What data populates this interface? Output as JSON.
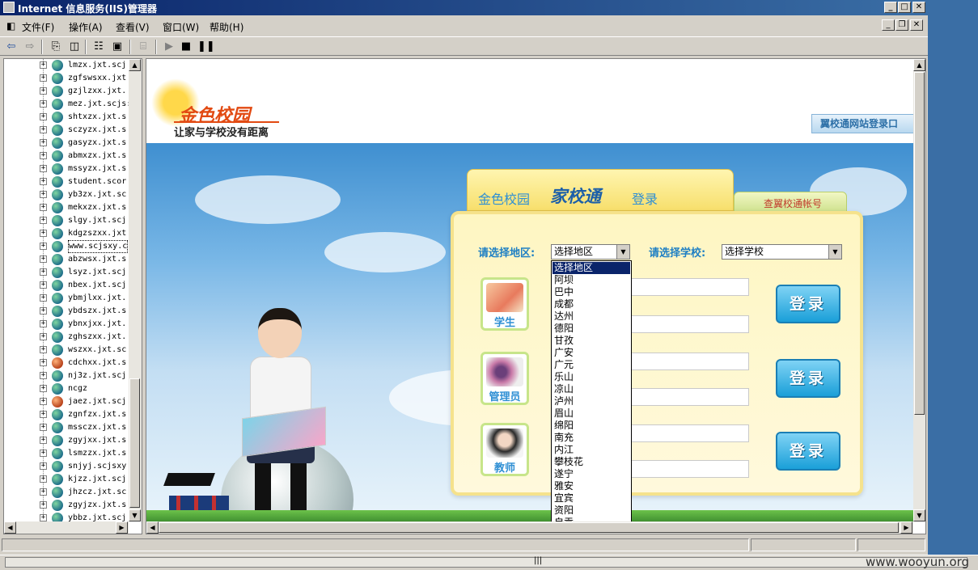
{
  "window": {
    "title": "Internet 信息服务(IIS)管理器"
  },
  "menu": {
    "file": "文件(F)",
    "action": "操作(A)",
    "view": "查看(V)",
    "window": "窗口(W)",
    "help": "帮助(H)"
  },
  "toolbar_icons": [
    "back-icon",
    "forward-icon",
    "up-folder-icon",
    "show-tree-icon",
    "properties-icon",
    "export-icon",
    "computer-icon",
    "play-icon",
    "stop-icon",
    "pause-icon"
  ],
  "tree": {
    "items": [
      "lmzx.jxt.scj",
      "zgfswsxx.jxt",
      "gzjlzxx.jxt.",
      "mez.jxt.scjs:",
      "shtxzx.jxt.s",
      "sczyzx.jxt.s",
      "gasyzx.jxt.s",
      "abmxzx.jxt.s",
      "mssyzx.jxt.s",
      "student.scor",
      "yb3zx.jxt.sc",
      "mekxzx.jxt.s",
      "slgy.jxt.scj",
      "kdgzszxx.jxt",
      "www.scjsxy.c",
      "abzwsx.jxt.s",
      "lsyz.jxt.scj",
      "nbex.jxt.scj",
      "ybmjlxx.jxt.",
      "ybdszx.jxt.s",
      "ybnxjxx.jxt.",
      "zghszxx.jxt.",
      "wszxx.jxt.sc",
      "cdchxx.jxt.s",
      "nj3z.jxt.scj",
      "ncgz",
      "jaez.jxt.scj",
      "zgnfzx.jxt.s",
      "mssczx.jxt.s",
      "zgyjxx.jxt.s",
      "lsmzzx.jxt.s",
      "snjyj.scjsxy",
      "kjzz.jxt.scj",
      "jhzcz.jxt.sc",
      "zgyjzx.jxt.s",
      "ybbz.jxt.scj"
    ],
    "selected_index": 14,
    "stopped_indices": [
      23,
      26
    ]
  },
  "site": {
    "logo_text": "金色校园",
    "slogan": "让家与学校没有距离",
    "top_banner": "翼校通网站登录口",
    "tab_title_1": "金色校园",
    "tab_title_2": "家校通",
    "tab_title_3": "登录",
    "side_tab": "查翼校通帐号",
    "region_label": "请选择地区:",
    "region_selected": "选择地区",
    "school_label": "请选择学校:",
    "school_selected": "选择学校",
    "roles": [
      "学生",
      "管理员",
      "教师"
    ],
    "login_label": "登录"
  },
  "dropdown": {
    "options": [
      "选择地区",
      "阿坝",
      "巴中",
      "成都",
      "达州",
      "德阳",
      "甘孜",
      "广安",
      "广元",
      "乐山",
      "凉山",
      "泸州",
      "眉山",
      "绵阳",
      "南充",
      "内江",
      "攀枝花",
      "遂宁",
      "雅安",
      "宜宾",
      "资阳",
      "自贡"
    ],
    "highlighted_index": 0
  },
  "status": {
    "watermark": "www.wooyun.org"
  },
  "colors": {
    "title_bar": "#0a246a",
    "panel_yellow": "#fef6c2",
    "accent_blue": "#1e7fc4",
    "login_button": "#1a9fd8"
  }
}
